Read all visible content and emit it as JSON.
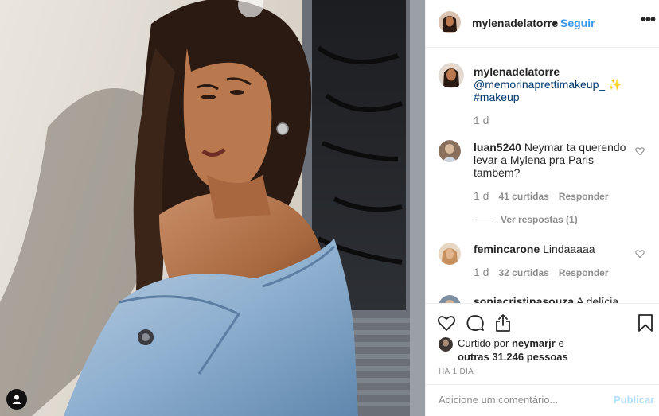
{
  "post": {
    "author": "mylenadelatorre",
    "dot": "•",
    "follow_label": "Seguir",
    "more_label": "•••"
  },
  "caption": {
    "user": "mylenadelatorre",
    "mention": "@memorinaprettimakeup_",
    "sparkle": "✨",
    "hashtag": "#makeup",
    "time": "1 d"
  },
  "comments": [
    {
      "user": "luan5240",
      "text": "Neymar ta querendo levar a Mylena pra Paris também?",
      "time": "1 d",
      "likes": "41 curtidas",
      "reply_label": "Responder",
      "view_replies": "Ver respostas (1)"
    },
    {
      "user": "femincarone",
      "text": "Lindaaaaa",
      "time": "1 d",
      "likes": "32 curtidas",
      "reply_label": "Responder"
    },
    {
      "user": "soniacristinasouza",
      "text": "A delícia do"
    }
  ],
  "liked_by": {
    "prefix": "Curtido por",
    "user": "neymarjr",
    "middle": "e",
    "others": "outras 31.246 pessoas"
  },
  "posted_ago": "HÁ 1 DIA",
  "add_comment": {
    "placeholder": "Adicione um comentário...",
    "post_label": "Publicar"
  },
  "colors": {
    "accent": "#3897f0",
    "post_disabled": "#b2dffc",
    "muted": "#8e8e8e"
  },
  "icons": [
    "user-tag-icon",
    "more-options-icon",
    "heart-icon",
    "comment-icon",
    "share-icon",
    "bookmark-icon"
  ]
}
